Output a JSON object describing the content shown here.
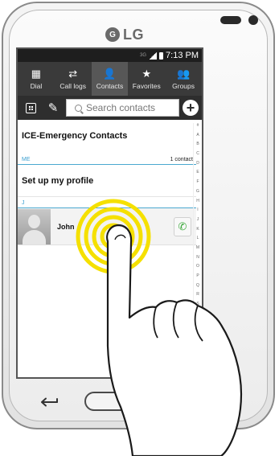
{
  "device": {
    "brand": "LG",
    "logo_glyph": "G"
  },
  "status_bar": {
    "sim": "3G",
    "time": "7:13 PM"
  },
  "tabs": [
    {
      "label": "Dial",
      "icon": "keypad-icon",
      "glyph": "▦",
      "active": false
    },
    {
      "label": "Call logs",
      "icon": "call-logs-icon",
      "glyph": "⇄",
      "active": false
    },
    {
      "label": "Contacts",
      "icon": "contacts-icon",
      "glyph": "👤",
      "active": true
    },
    {
      "label": "Favorites",
      "icon": "star-icon",
      "glyph": "★",
      "active": false
    },
    {
      "label": "Groups",
      "icon": "groups-icon",
      "glyph": "👥",
      "active": false
    }
  ],
  "toolbar": {
    "search_placeholder": "Search contacts",
    "add_glyph": "+"
  },
  "list": {
    "ice_label": "ICE-Emergency Contacts",
    "me_section": "ME",
    "me_count": "1 contact",
    "profile_label": "Set up my profile",
    "letter_section": "J",
    "contacts": [
      {
        "name": "John"
      }
    ]
  },
  "alpha_index": [
    "#",
    "A",
    "B",
    "C",
    "D",
    "E",
    "F",
    "G",
    "H",
    "I",
    "J",
    "K",
    "L",
    "M",
    "N",
    "O",
    "P",
    "Q",
    "R",
    "S",
    "T",
    "U",
    "V",
    "W",
    "X",
    "Y",
    "Z"
  ],
  "colors": {
    "accent": "#3a9fd0",
    "tap_ring": "#f5e000",
    "call": "#3aa83a"
  }
}
